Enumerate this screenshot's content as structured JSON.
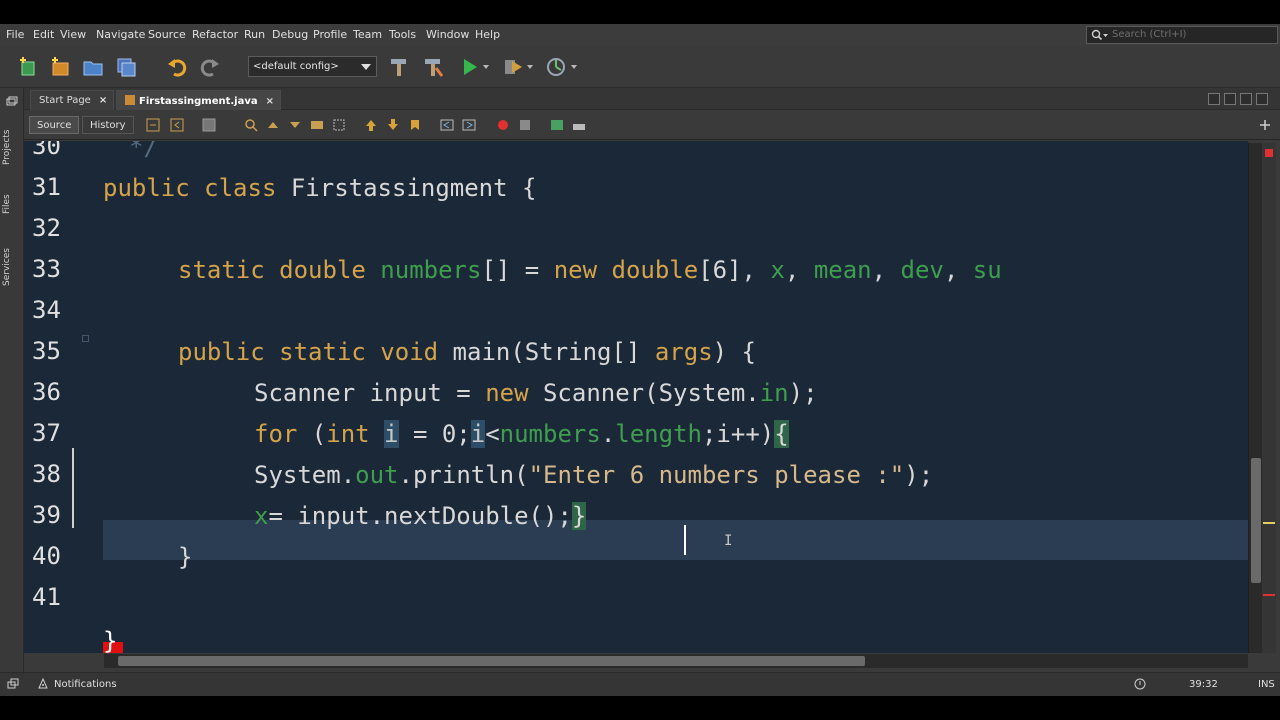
{
  "menubar": {
    "items": [
      "File",
      "Edit",
      "View",
      "Navigate",
      "Source",
      "Refactor",
      "Run",
      "Debug",
      "Profile",
      "Team",
      "Tools",
      "Window",
      "Help"
    ],
    "search_placeholder": "Search (Ctrl+I)"
  },
  "toolbar": {
    "config": "<default config>"
  },
  "sidebar": {
    "tabs": [
      "Projects",
      "Files",
      "Services"
    ]
  },
  "tabs": [
    {
      "label": "Start Page",
      "close": "×"
    },
    {
      "label": "Firstassingment.java",
      "close": "×"
    }
  ],
  "editor_toolbar": {
    "source": "Source",
    "history": "History"
  },
  "editor": {
    "line_numbers": [
      "30",
      "31",
      "32",
      "33",
      "34",
      "35",
      "36",
      "37",
      "38",
      "39",
      "40",
      "41"
    ],
    "partial_line": "*/",
    "lines": {
      "l31": {
        "kw": "public class ",
        "rest": "Firstassingment {"
      },
      "l33": {
        "kw1": "static double ",
        "f1": "numbers",
        "t1": "[] = ",
        "kw2": "new double",
        "t2": "[6], ",
        "f2": "x",
        "t3": ", ",
        "f3": "mean",
        "t4": ", ",
        "f4": "dev",
        "t5": ", ",
        "f5": "su"
      },
      "l35": {
        "kw": "public static void ",
        "t1": "main(String[] ",
        "arg": "args",
        "t2": ") {"
      },
      "l36": {
        "t1": "Scanner input = ",
        "kw": "new ",
        "t2": "Scanner(System.",
        "f": "in",
        "t3": ");"
      },
      "l37": {
        "kw1": "for ",
        "t1": "(",
        "kw2": "int ",
        "v1": "i",
        "t2": " = 0;",
        "v2": "i",
        "t3": "<",
        "f1": "numbers",
        "t4": ".",
        "f2": "length",
        "t5": ";i++)",
        "b": "{"
      },
      "l38": {
        "t1": "System.",
        "f": "out",
        "t2": ".println(",
        "s": "\"Enter 6 numbers please :\"",
        "t3": ");"
      },
      "l39": {
        "f": "x",
        "t1": "= input.nextDouble();",
        "b": "}"
      },
      "l40": {
        "t": "}"
      },
      "l42": {
        "t": "}"
      }
    }
  },
  "statusbar": {
    "notifications": "Notifications",
    "position": "39:32",
    "mode": "INS"
  }
}
